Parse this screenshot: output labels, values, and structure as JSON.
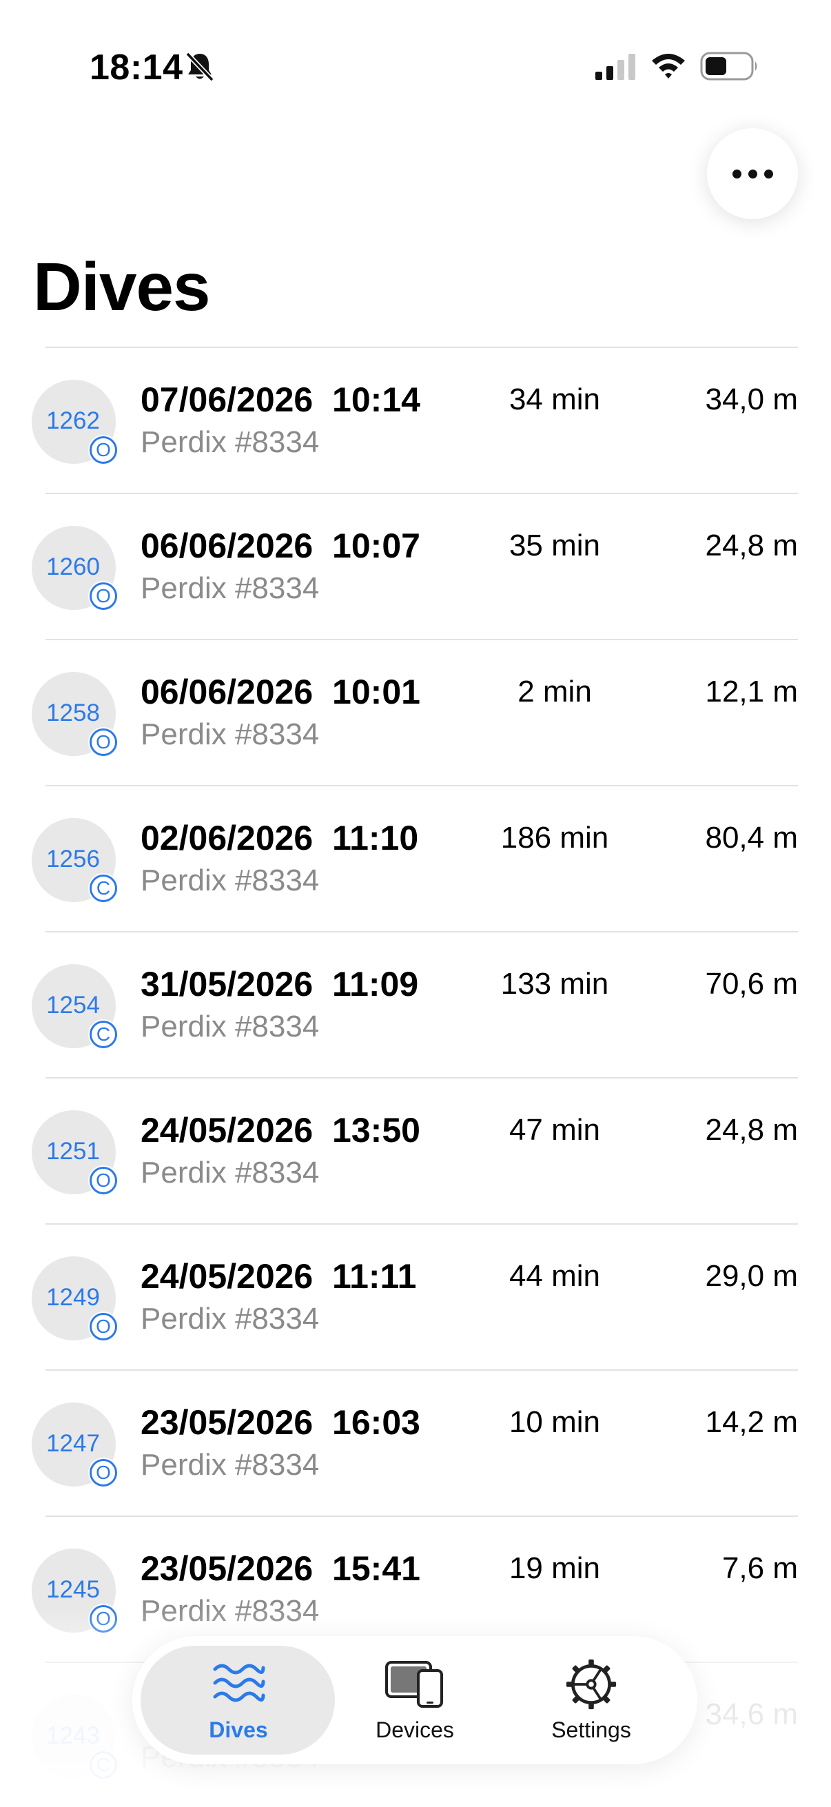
{
  "status_bar": {
    "time": "18:14",
    "icons": [
      "bell-slash-icon",
      "cellular-signal-icon",
      "wifi-icon",
      "battery-icon"
    ]
  },
  "header": {
    "more_button_icon": "ellipsis-icon",
    "title": "Dives"
  },
  "colors": {
    "accent": "#2b7ae8",
    "badge_bg": "#e8e8e8",
    "secondary_text": "#8a8a8a"
  },
  "dives": [
    {
      "number": "1262",
      "mode": "O",
      "date": "07/06/2026",
      "time": "10:14",
      "device": "Perdix #8334",
      "duration": "34 min",
      "depth": "34,0 m"
    },
    {
      "number": "1260",
      "mode": "O",
      "date": "06/06/2026",
      "time": "10:07",
      "device": "Perdix #8334",
      "duration": "35 min",
      "depth": "24,8 m"
    },
    {
      "number": "1258",
      "mode": "O",
      "date": "06/06/2026",
      "time": "10:01",
      "device": "Perdix #8334",
      "duration": "2 min",
      "depth": "12,1 m"
    },
    {
      "number": "1256",
      "mode": "C",
      "date": "02/06/2026",
      "time": "11:10",
      "device": "Perdix #8334",
      "duration": "186 min",
      "depth": "80,4 m"
    },
    {
      "number": "1254",
      "mode": "C",
      "date": "31/05/2026",
      "time": "11:09",
      "device": "Perdix #8334",
      "duration": "133 min",
      "depth": "70,6 m"
    },
    {
      "number": "1251",
      "mode": "O",
      "date": "24/05/2026",
      "time": "13:50",
      "device": "Perdix #8334",
      "duration": "47 min",
      "depth": "24,8 m"
    },
    {
      "number": "1249",
      "mode": "O",
      "date": "24/05/2026",
      "time": "11:11",
      "device": "Perdix #8334",
      "duration": "44 min",
      "depth": "29,0 m"
    },
    {
      "number": "1247",
      "mode": "O",
      "date": "23/05/2026",
      "time": "16:03",
      "device": "Perdix #8334",
      "duration": "10 min",
      "depth": "14,2 m"
    },
    {
      "number": "1245",
      "mode": "O",
      "date": "23/05/2026",
      "time": "15:41",
      "device": "Perdix #8334",
      "duration": "19 min",
      "depth": "7,6 m"
    },
    {
      "number": "1243",
      "mode": "C",
      "date": "",
      "time": "",
      "device": "Perdix #8334",
      "duration": "",
      "depth": "34,6 m"
    }
  ],
  "tab_bar": {
    "tabs": [
      {
        "label": "Dives",
        "icon": "waves-icon",
        "selected": true
      },
      {
        "label": "Devices",
        "icon": "devices-icon",
        "selected": false
      },
      {
        "label": "Settings",
        "icon": "gear-icon",
        "selected": false
      }
    ]
  }
}
